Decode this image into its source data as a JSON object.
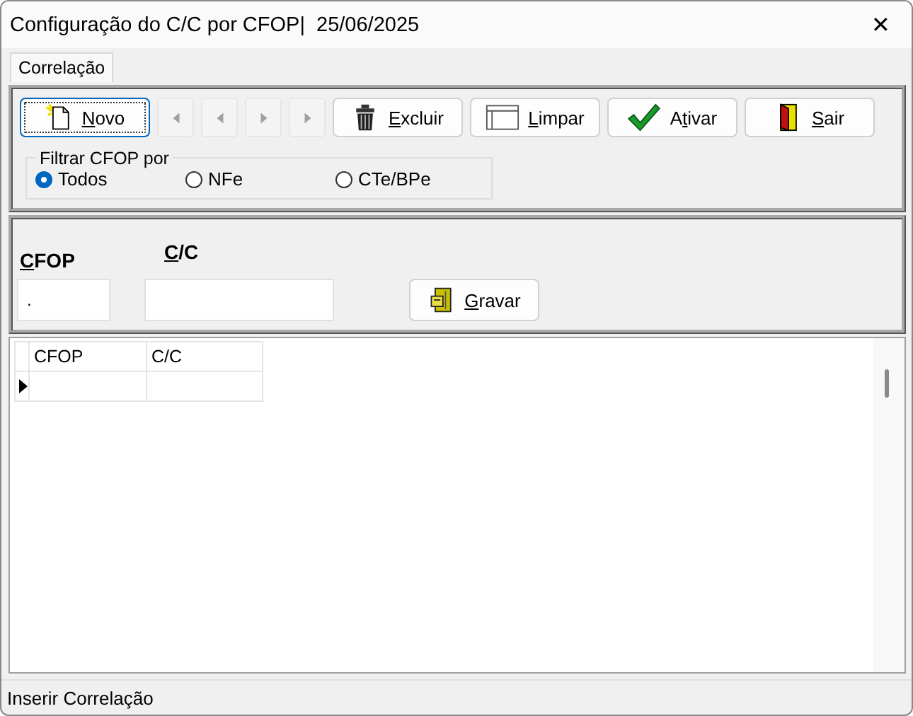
{
  "window": {
    "title": "Configuração do C/C por CFOP|  25/06/2025",
    "close": "✕"
  },
  "tabs": [
    {
      "label": "Correlação",
      "selected": true
    }
  ],
  "toolbar": [
    {
      "kind": "button",
      "label": "Novo",
      "focused": true
    },
    {
      "kind": "nav",
      "disabled": true
    },
    {
      "kind": "nav",
      "disabled": true
    },
    {
      "kind": "nav",
      "disabled": true
    },
    {
      "kind": "nav",
      "disabled": true
    },
    {
      "kind": "button",
      "label": "Excluir",
      "focused": false
    },
    {
      "kind": "button",
      "label": "Limpar",
      "focused": false
    },
    {
      "kind": "button",
      "label": "Ativar",
      "focused": false
    },
    {
      "kind": "button",
      "label": "Sair",
      "focused": false
    }
  ],
  "filter": {
    "legend": "Filtrar CFOP por",
    "options": [
      {
        "label": "Todos",
        "selected": true
      },
      {
        "label": "NFe",
        "selected": false
      },
      {
        "label": "CTe/BPe",
        "selected": false
      }
    ]
  },
  "form": {
    "fields": [
      {
        "label": "CFOP",
        "value": "."
      },
      {
        "label": "C/C"
      }
    ],
    "save": {
      "label": "Gravar"
    }
  },
  "grid": {
    "columns": [
      "CFOP",
      "C/C"
    ],
    "rows": [
      {
        "current": true,
        "cells": [
          "",
          ""
        ]
      }
    ]
  },
  "status_bar": "Inserir Correlação"
}
